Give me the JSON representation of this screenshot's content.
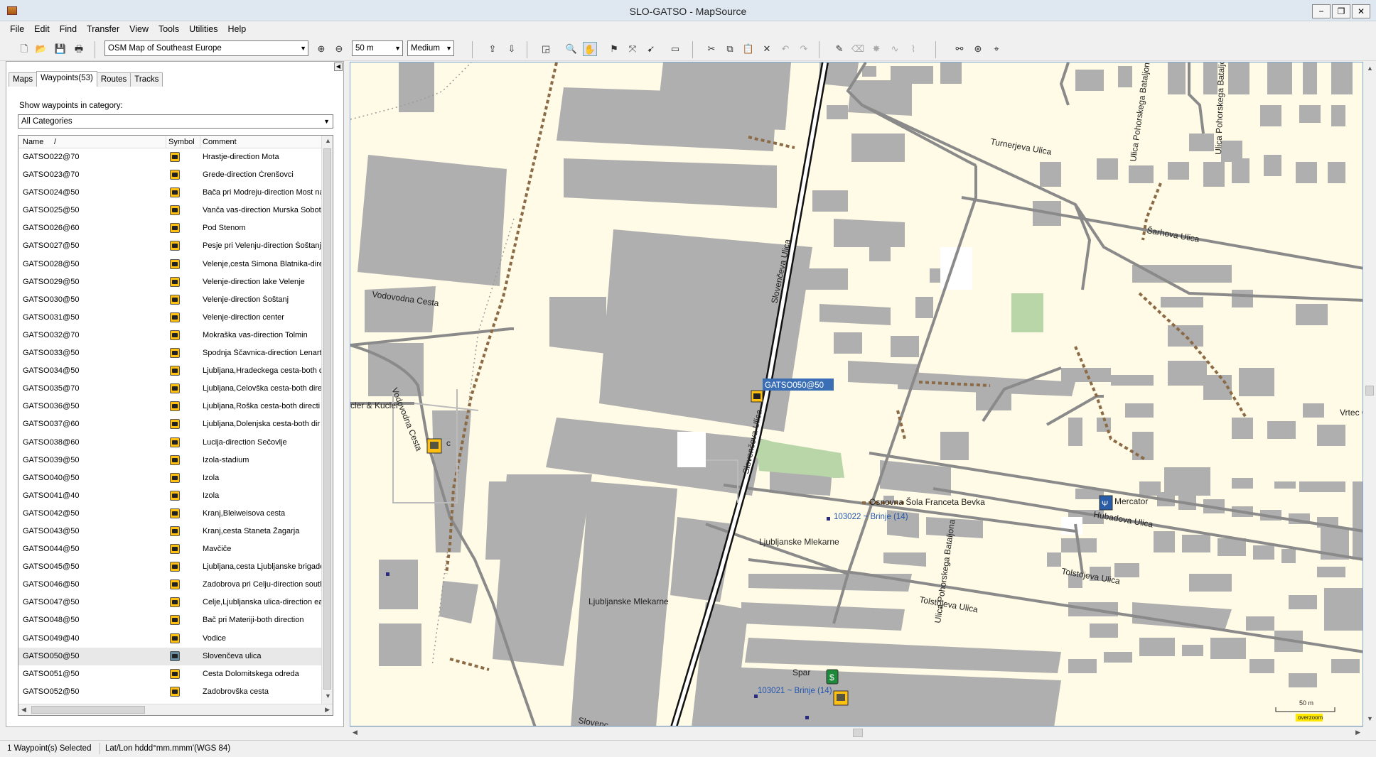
{
  "window": {
    "title": "SLO-GATSO - MapSource"
  },
  "menu": [
    "File",
    "Edit",
    "Find",
    "Transfer",
    "View",
    "Tools",
    "Utilities",
    "Help"
  ],
  "toolbar": {
    "map_product": "OSM Map of Southeast Europe",
    "zoom_scale": "50 m",
    "detail_level": "Medium"
  },
  "tabs": {
    "maps": "Maps",
    "waypoints": "Waypoints(53)",
    "routes": "Routes",
    "tracks": "Tracks"
  },
  "filter": {
    "label": "Show waypoints in category:",
    "value": "All Categories"
  },
  "list": {
    "columns": {
      "name": "Name",
      "sort_indicator": "/",
      "symbol": "Symbol",
      "comment": "Comment"
    },
    "rows": [
      {
        "name": "GATSO022@70",
        "comment": "Hrastje-direction Mota"
      },
      {
        "name": "GATSO023@70",
        "comment": "Grede-direction Črenšovci"
      },
      {
        "name": "GATSO024@50",
        "comment": "Bača pri Modreju-direction Most na"
      },
      {
        "name": "GATSO025@50",
        "comment": "Vanča vas-direction Murska Sobota"
      },
      {
        "name": "GATSO026@60",
        "comment": "Pod Stenom"
      },
      {
        "name": "GATSO027@50",
        "comment": "Pesje pri Velenju-direction Šoštanj"
      },
      {
        "name": "GATSO028@50",
        "comment": "Velenje,cesta Simona Blatnika-dire"
      },
      {
        "name": "GATSO029@50",
        "comment": "Velenje-direction lake Velenje"
      },
      {
        "name": "GATSO030@50",
        "comment": "Velenje-direction Šoštanj"
      },
      {
        "name": "GATSO031@50",
        "comment": "Velenje-direction center"
      },
      {
        "name": "GATSO032@70",
        "comment": "Mokraška vas-direction Tolmin"
      },
      {
        "name": "GATSO033@50",
        "comment": "Spodnja Ščavnica-direction Lenart"
      },
      {
        "name": "GATSO034@50",
        "comment": "Ljubljana,Hradeckega cesta-both d"
      },
      {
        "name": "GATSO035@70",
        "comment": "Ljubljana,Celovška cesta-both dire"
      },
      {
        "name": "GATSO036@50",
        "comment": "Ljubljana,Roška cesta-both directi"
      },
      {
        "name": "GATSO037@60",
        "comment": "Ljubljana,Dolenjska cesta-both dir"
      },
      {
        "name": "GATSO038@60",
        "comment": "Lucija-direction Sečovlje"
      },
      {
        "name": "GATSO039@50",
        "comment": "Izola-stadium"
      },
      {
        "name": "GATSO040@50",
        "comment": "Izola"
      },
      {
        "name": "GATSO041@40",
        "comment": "Izola"
      },
      {
        "name": "GATSO042@50",
        "comment": "Kranj,Bleiweisova cesta"
      },
      {
        "name": "GATSO043@50",
        "comment": "Kranj,cesta Staneta Žagarja"
      },
      {
        "name": "GATSO044@50",
        "comment": "Mavčiče"
      },
      {
        "name": "GATSO045@50",
        "comment": "Ljubljana,cesta Ljubljanske brigade"
      },
      {
        "name": "GATSO046@50",
        "comment": "Zadobrova pri Celju-direction south"
      },
      {
        "name": "GATSO047@50",
        "comment": "Celje,Ljubljanska ulica-direction ea"
      },
      {
        "name": "GATSO048@50",
        "comment": "Bač pri Materiji-both direction"
      },
      {
        "name": "GATSO049@40",
        "comment": "Vodice"
      },
      {
        "name": "GATSO050@50",
        "comment": "Slovenčeva ulica"
      },
      {
        "name": "GATSO051@50",
        "comment": "Cesta Dolomitskega odreda"
      },
      {
        "name": "GATSO052@50",
        "comment": "Zadobrovška cesta"
      }
    ],
    "selected_index": 28
  },
  "map": {
    "streets": {
      "vodovodna_cesta": "Vodovodna Cesta",
      "vodovodna_cesta_2": "Vodovodna Cesta",
      "slovenceva_ulica": "Slovenčeva Ulica",
      "slovenceva_ulica_2": "Slovenčeva Ulica",
      "turnerjeva_ulica": "Turnerjeva Ulica",
      "sarhova_ulica": "Šarhova Ulica",
      "hubadova_ulica": "Hubadova Ulica",
      "tolstojeva_ulica": "Tolstojeva Ulica",
      "tolstojeva_ulica_2": "Tolstojeva Ulica",
      "ulica_pohorskega_bataljona": "Ulica Pohorskega Bataljona",
      "ulica_pohorskega_bataljona_2": "Ulica Pohorskega Bataljona",
      "ulica_pohorskega_bataljona_3": "Ulica Pohorskega Bataljona",
      "slovenc_bottom": "Slovenc"
    },
    "places": {
      "kucler": "cler & Kucler",
      "osnovna_sola": "Osnovna Šola Franceta Bevka",
      "ljubljanske_mlekarne": "Ljubljanske Mlekarne",
      "ljubljanske_mlekarne_2": "Ljubljanske Mlekarne",
      "mercator": "Mercator",
      "spar": "Spar",
      "vrtec": "Vrtec Cic",
      "stub_c": "c"
    },
    "waypoint_label": "GATSO050@50",
    "address_1": "103022 ~ Brinje (14)",
    "address_2": "103021 ~ Brinje (14)",
    "scale_text": "50 m",
    "overzoom": "overzoom"
  },
  "status": {
    "selection": "1 Waypoint(s) Selected",
    "coords": "Lat/Lon hddd°mm.mmm'(WGS 84)"
  }
}
